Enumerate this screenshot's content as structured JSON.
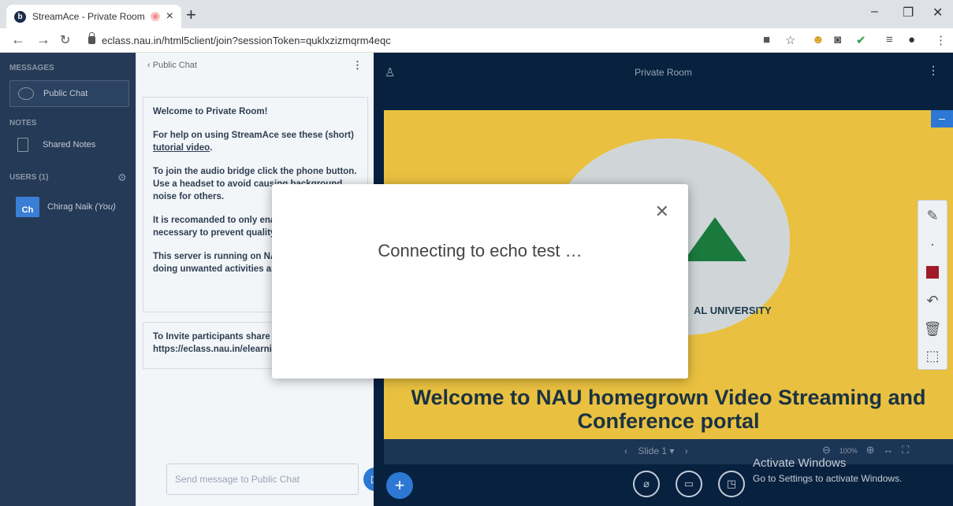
{
  "browser": {
    "tab_title": "StreamAce - Private Room",
    "url": "eclass.nau.in/html5client/join?sessionToken=quklxzizmqrm4eqc"
  },
  "sidebar": {
    "messages_title": "MESSAGES",
    "public_chat_label": "Public Chat",
    "notes_title": "NOTES",
    "shared_notes_label": "Shared Notes",
    "users_title": "USERS (1)",
    "user": {
      "initials": "Ch",
      "name": "Chirag Naik",
      "you_label": "(You)"
    }
  },
  "chat": {
    "header": "Public Chat",
    "welcome": {
      "heading": "Welcome to Private Room!",
      "help_text": "For help on using StreamAce see these (short)",
      "help_link": "tutorial video",
      "help_end": ".",
      "audio_text": "To join the audio bridge click the phone button. Use a headset to avoid causing background noise for others.",
      "recommend_text": "It is recomanded to only enable camera when necessary to prevent quality issues.",
      "server_text": "This server is running on NAU servers, avoid doing unwanted activities and"
    },
    "invite": {
      "text": "To Invite participants share this URL:",
      "url": "https://eclass.nau.in/elearning"
    },
    "input_placeholder": "Send message to Public Chat"
  },
  "main": {
    "room_title": "Private Room",
    "slide_university_text": "AL UNIVERSITY",
    "slide_heading": "Welcome to NAU homegrown Video Streaming and Conference portal",
    "slide_nav_label": "Slide 1",
    "zoom_level": "100%"
  },
  "modal": {
    "message": "Connecting to echo test …"
  },
  "os_watermark": {
    "title": "Activate Windows",
    "subtitle": "Go to Settings to activate Windows."
  },
  "colors": {
    "sidebar_bg": "#243a56",
    "main_bg": "#07213f",
    "slide_bg": "#e9c040",
    "accent": "#2d78d4"
  }
}
